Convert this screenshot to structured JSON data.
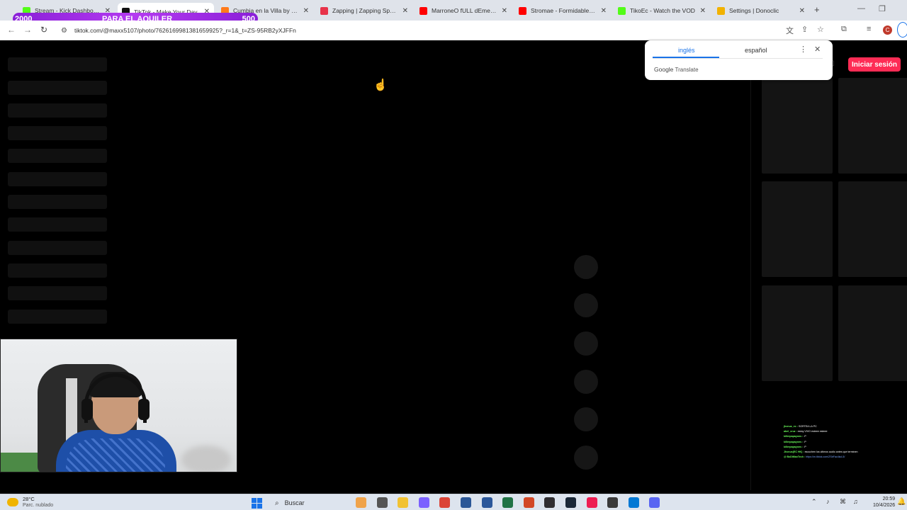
{
  "overlay": {
    "left_count": "2000",
    "label": "PARA EL AQUILER",
    "right_count": "500"
  },
  "browser": {
    "tabs": [
      {
        "title": "Stream - Kick Dashboard",
        "color": "#53fc18"
      },
      {
        "title": "TikTok - Make Your Day",
        "color": "#111111"
      },
      {
        "title": "Cumbia en la Villa by 4zfl",
        "color": "#ff7a1a"
      },
      {
        "title": "Zapping | Zapping Sports",
        "color": "#e8334a"
      },
      {
        "title": "MarroneO fULL dEmenCi",
        "color": "#ff0000"
      },
      {
        "title": "Stromae - Formidable (Li",
        "color": "#ff0000"
      },
      {
        "title": "TikoEc - Watch the VOD",
        "color": "#53fc18"
      },
      {
        "title": "Settings | Donoclic",
        "color": "#f2b200"
      }
    ],
    "url": "tiktok.com/@maxx5107/photo/7626169981381659925?_r=1&_t=ZS-95RB2yXJFFn"
  },
  "icons": {
    "back": "arrow-left-icon",
    "forward": "arrow-right-icon",
    "reload": "reload-icon",
    "site_info": "tune-icon",
    "translate": "translate-icon",
    "install": "install-icon",
    "bookmark": "star-icon",
    "extensions": "puzzle-icon",
    "reading": "list-icon",
    "profile": "profile-icon",
    "menu": "kebab-menu-icon",
    "close": "close-icon",
    "new_tab": "plus-icon",
    "cursor": "hand-cursor-icon"
  },
  "translate": {
    "source_lang": "inglés",
    "target_lang": "español",
    "brand_google": "Google",
    "brand_translate": "Translate"
  },
  "page": {
    "login_button": "Iniciar sesión",
    "profile_initial": "C"
  },
  "chat": {
    "messages": [
      {
        "user": "jhonus_ec :",
        "text": "SORTEA LA PC"
      },
      {
        "user": "abel_cruz :",
        "text": "estoy VIVO esteee esteee"
      },
      {
        "user": "killerpapayons :",
        "text": ":P"
      },
      {
        "user": "killerpapayons :",
        "text": ":P"
      },
      {
        "user": "killerpapayons :",
        "text": ":P"
      },
      {
        "user": "Jhonus(EC HK) :",
        "text": "escuchen los ultimos audio antes que terminen"
      },
      {
        "user": "@ BoDiMaxTech :",
        "text": "https://m.tiktok.com/ZSbFac4kcL5/"
      }
    ]
  },
  "taskbar": {
    "temperature": "28°C",
    "condition": "Parc. nublado",
    "search_placeholder": "Buscar",
    "time": "20:59",
    "date": "10/4/2026",
    "apps": [
      {
        "icon": "widgets-icon",
        "color": "#f0a34a"
      },
      {
        "icon": "file-explorer-icon",
        "color": "#555555"
      },
      {
        "icon": "folder-icon",
        "color": "#f1c232"
      },
      {
        "icon": "copilot-icon",
        "color": "#7b61ff"
      },
      {
        "icon": "chrome-icon",
        "color": "#db4437"
      },
      {
        "icon": "store-icon",
        "color": "#2b5797"
      },
      {
        "icon": "word-icon",
        "color": "#2b579a"
      },
      {
        "icon": "excel-icon",
        "color": "#217346"
      },
      {
        "icon": "powerpoint-icon",
        "color": "#d24726"
      },
      {
        "icon": "obs-icon",
        "color": "#302e31"
      },
      {
        "icon": "steam-icon",
        "color": "#1b2838"
      },
      {
        "icon": "tiktok-icon",
        "color": "#ee1d52"
      },
      {
        "icon": "calculator-icon",
        "color": "#3a3a3a"
      },
      {
        "icon": "settings-app-icon",
        "color": "#0078d4"
      },
      {
        "icon": "discord-icon",
        "color": "#5865f2"
      }
    ]
  },
  "colors": {
    "accent": "#fe2c55",
    "overlay": "#a52fe6",
    "link": "#1a73e8"
  }
}
